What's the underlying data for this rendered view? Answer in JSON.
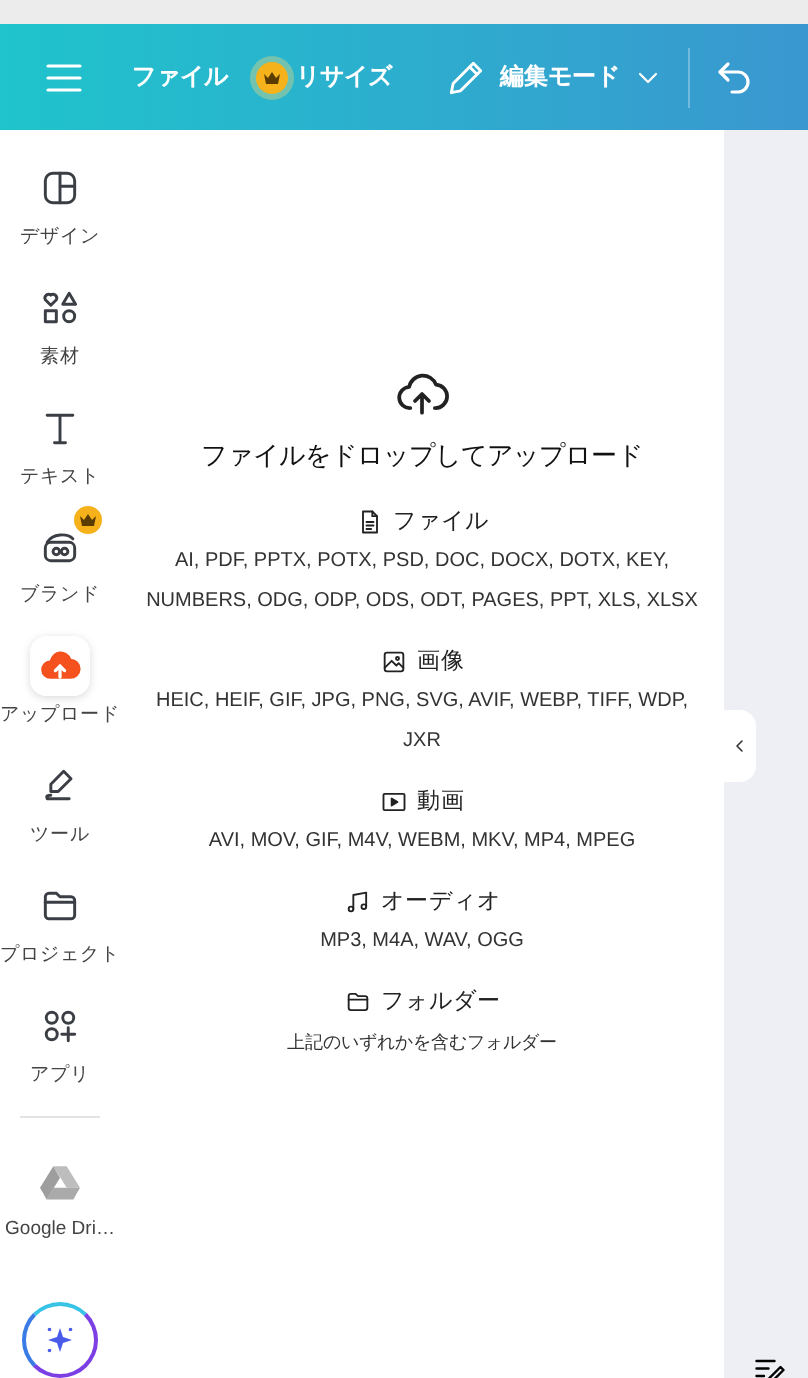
{
  "topbar": {
    "items": [
      {
        "label": "ファイル",
        "premium": false
      },
      {
        "label": "リサイズ",
        "premium": true
      }
    ],
    "edit_mode": "編集モード"
  },
  "sidebar": {
    "items": [
      {
        "kind": "design",
        "label": "デザイン",
        "selected": false,
        "premium": false
      },
      {
        "kind": "elements",
        "label": "素材",
        "selected": false,
        "premium": false
      },
      {
        "kind": "text",
        "label": "テキスト",
        "selected": false,
        "premium": false
      },
      {
        "kind": "brand",
        "label": "ブランド",
        "selected": false,
        "premium": true
      },
      {
        "kind": "upload",
        "label": "アップロード",
        "selected": true,
        "premium": false
      },
      {
        "kind": "tools",
        "label": "ツール",
        "selected": false,
        "premium": false
      },
      {
        "kind": "projects",
        "label": "プロジェクト",
        "selected": false,
        "premium": false
      },
      {
        "kind": "apps",
        "label": "アプリ",
        "selected": false,
        "premium": false
      }
    ],
    "extras": [
      {
        "kind": "drive",
        "label": "Google Dri…"
      }
    ]
  },
  "upload_panel": {
    "title": "ファイルをドロップしてアップロード",
    "sections": [
      {
        "kind": "file",
        "heading": "ファイル",
        "formats": "AI, PDF, PPTX, POTX, PSD, DOC, DOCX, DOTX, KEY, NUMBERS, ODG, ODP, ODS, ODT, PAGES, PPT, XLS, XLSX"
      },
      {
        "kind": "image",
        "heading": "画像",
        "formats": "HEIC, HEIF, GIF, JPG, PNG, SVG, AVIF, WEBP, TIFF, WDP, JXR"
      },
      {
        "kind": "video",
        "heading": "動画",
        "formats": "AVI, MOV, GIF, M4V, WEBM, MKV, MP4, MPEG"
      },
      {
        "kind": "audio",
        "heading": "オーディオ",
        "formats": "MP3, M4A, WAV, OGG"
      },
      {
        "kind": "folder",
        "heading": "フォルダー",
        "formats": "上記のいずれかを含むフォルダー"
      }
    ]
  }
}
